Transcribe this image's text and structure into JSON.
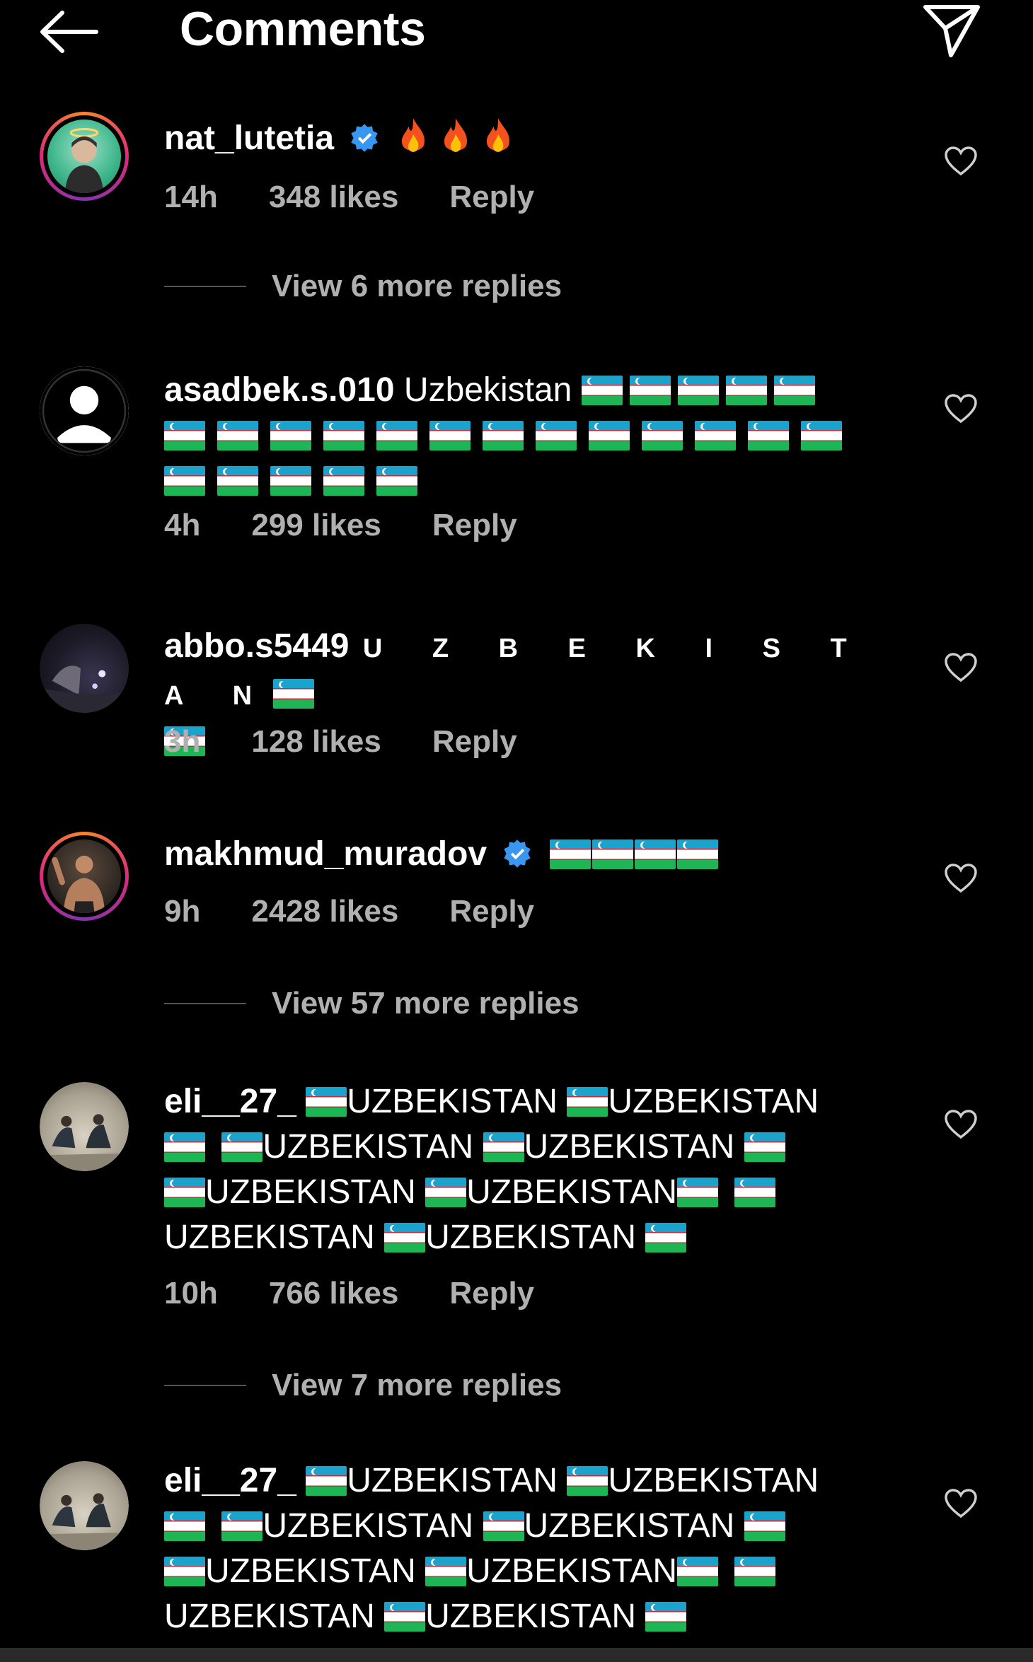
{
  "header": {
    "title": "Comments",
    "back_icon": "arrow-left-icon",
    "send_icon": "paper-plane-icon"
  },
  "colors": {
    "background": "#000000",
    "text": "#ffffff",
    "muted": "#b0b0b0",
    "verified": "#3897f0"
  },
  "comments": [
    {
      "username": "nat_lutetia",
      "verified": true,
      "text": "🔥🔥🔥",
      "time": "14h",
      "likes": "348 likes",
      "reply": "Reply",
      "view_replies": "View 6 more replies"
    },
    {
      "username": "asadbek.s.010",
      "verified": false,
      "text": "Uzbekistan",
      "flag_count": 23,
      "time": "4h",
      "likes": "299 likes",
      "reply": "Reply"
    },
    {
      "username": "abbo.s5449",
      "verified": false,
      "text": "U Z B E K I S T A N",
      "time": "3h",
      "likes": "128 likes",
      "reply": "Reply"
    },
    {
      "username": "makhmud_muradov",
      "verified": true,
      "text": "",
      "time": "9h",
      "likes": "2428 likes",
      "reply": "Reply",
      "view_replies": "View 57 more replies"
    },
    {
      "username": "eli__27_",
      "verified": false,
      "text": "UZBEKISTAN",
      "time": "10h",
      "likes": "766 likes",
      "reply": "Reply",
      "view_replies": "View 7 more replies"
    },
    {
      "username": "eli__27_",
      "verified": false,
      "text": "UZBEKISTAN"
    }
  ]
}
